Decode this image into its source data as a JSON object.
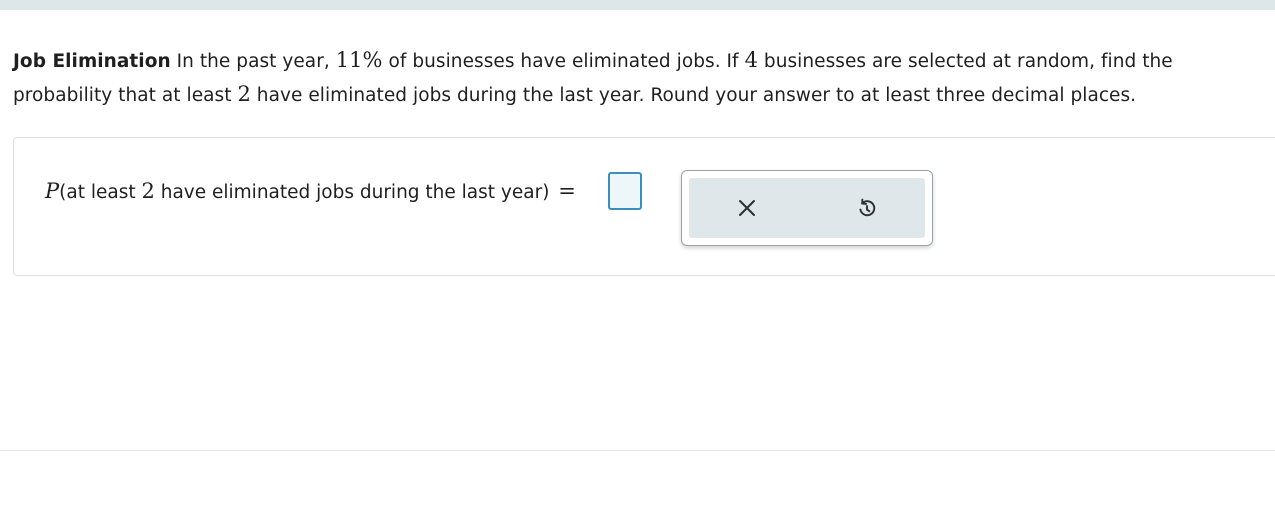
{
  "problem": {
    "title": "Job Elimination",
    "segments": [
      {
        "text": " In the past year, ",
        "style": "text"
      },
      {
        "text": "11",
        "style": "math"
      },
      {
        "text": "%",
        "style": "math"
      },
      {
        "text": " of businesses have eliminated jobs. If ",
        "style": "text"
      },
      {
        "text": "4",
        "style": "math"
      },
      {
        "text": " businesses are selected at random, find the probability that at least ",
        "style": "text"
      },
      {
        "text": "2",
        "style": "math"
      },
      {
        "text": " have eliminated jobs during the last year. Round your answer to at least three decimal places.",
        "style": "text"
      }
    ]
  },
  "answer": {
    "p_symbol": "P",
    "paren_text_before": "(at least ",
    "paren_number": "2",
    "paren_text_after": " have eliminated jobs during the last year)",
    "equals": "=",
    "input_value": ""
  },
  "toolbar": {
    "clear_icon": "close-icon",
    "undo_icon": "undo-icon"
  },
  "colors": {
    "input_border": "#3a8fbd",
    "input_fill": "#edf6f9",
    "toolbar_fill": "#e0e7ea",
    "top_bar": "#dfe6e8"
  }
}
